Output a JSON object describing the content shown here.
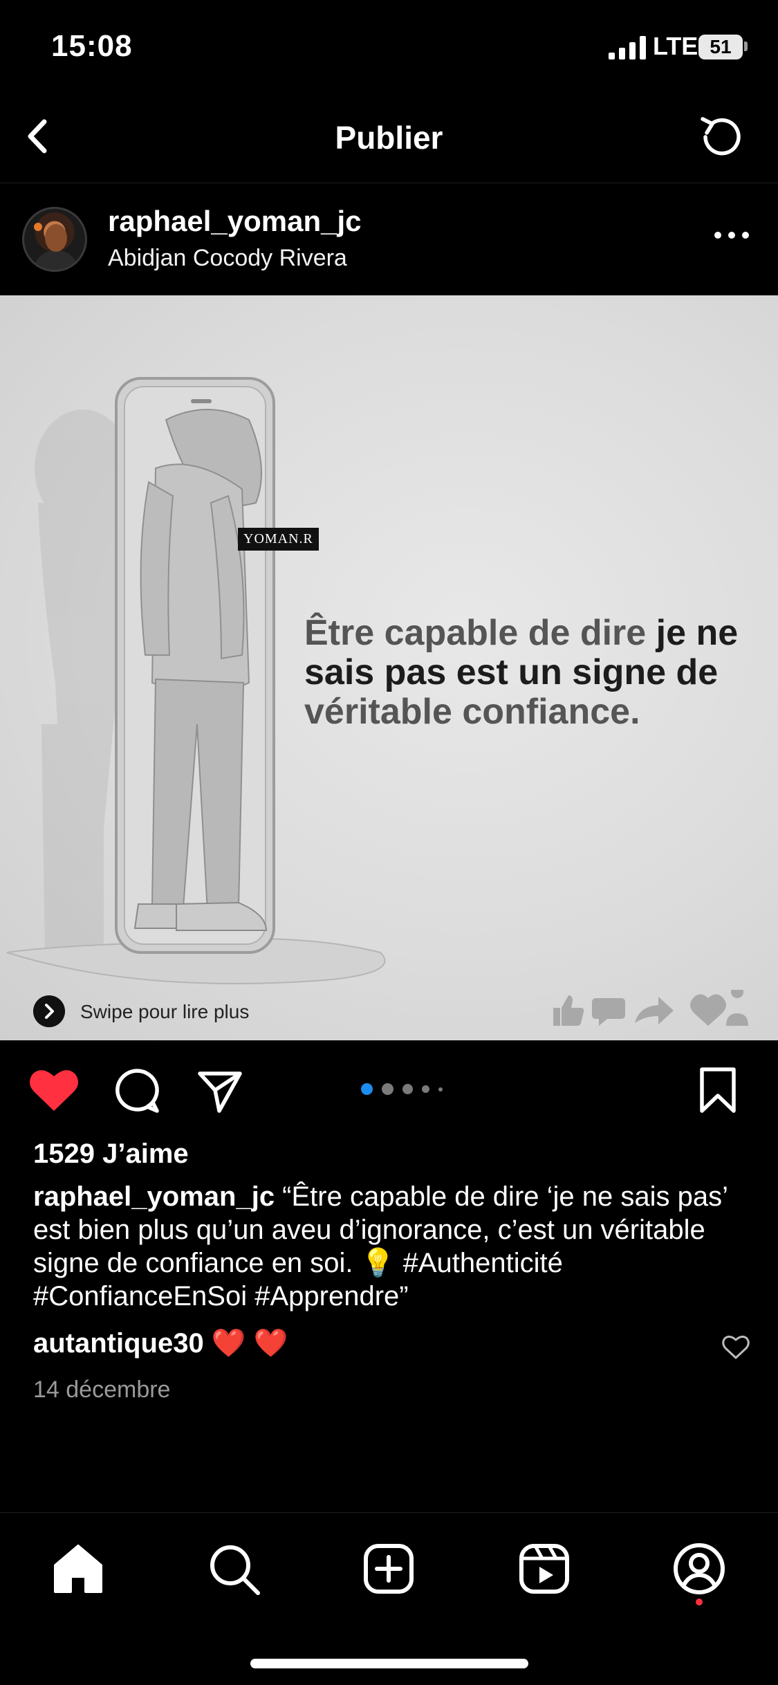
{
  "status_bar": {
    "time": "15:08",
    "network": "LTE",
    "battery": "51"
  },
  "header": {
    "title": "Publier",
    "back_icon": "chevron-left-icon",
    "refresh_icon": "refresh-icon"
  },
  "post": {
    "username": "raphael_yoman_jc",
    "location": "Abidjan Cocody Rivera",
    "image": {
      "watermark": "YOMAN.R",
      "quote_parts": [
        "Être capable de dire ",
        "je ne sais pas est un signe de ",
        "véritable confiance."
      ],
      "swipe_text": "Swipe pour lire plus"
    },
    "carousel": {
      "count": 5,
      "active": 0
    },
    "likes": "1529 J’aime",
    "caption_user": "raphael_yoman_jc",
    "caption_text": " “Être capable de dire ‘je ne sais pas’ est bien plus qu’un aveu d’ignorance, c’est un véritable signe de confiance en soi. 💡 #Authenticité #ConfianceEnSoi #Apprendre”",
    "comment_user": "autantique30",
    "comment_text": " ❤️ ❤️",
    "date": "14 décembre"
  },
  "colors": {
    "background": "#000000",
    "like_red": "#ff3040",
    "active_dot": "#1d8cf0"
  }
}
